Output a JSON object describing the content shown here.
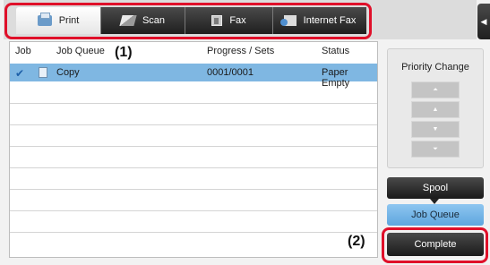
{
  "tabs": [
    {
      "label": "Print",
      "icon": "printer-icon",
      "active": true
    },
    {
      "label": "Scan",
      "icon": "scanner-icon",
      "active": false
    },
    {
      "label": "Fax",
      "icon": "fax-icon",
      "active": false
    },
    {
      "label": "Internet Fax",
      "icon": "internet-fax-icon",
      "active": false
    }
  ],
  "side_tab_glyph": "◀",
  "table": {
    "headers": [
      "Job",
      "Job Queue",
      "Progress / Sets",
      "Status"
    ],
    "rows": [
      {
        "selected": true,
        "check": "✔",
        "job_queue": "Copy",
        "progress": "0001/0001",
        "status": "Paper Empty"
      }
    ]
  },
  "priority": {
    "title": "Priority Change",
    "buttons": [
      "⏶",
      "▲",
      "▼",
      "⏷"
    ]
  },
  "actions": {
    "spool": "Spool",
    "job_queue": "Job Queue",
    "complete": "Complete"
  },
  "callouts": {
    "one": "(1)",
    "two": "(2)"
  },
  "colors": {
    "highlight": "#e0102a",
    "selected_row": "#7fb7e2",
    "job_queue_button": "#5ea6de"
  }
}
